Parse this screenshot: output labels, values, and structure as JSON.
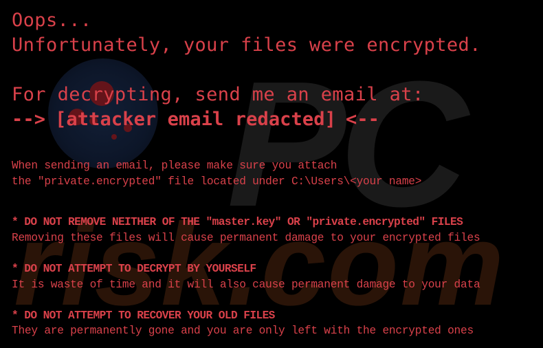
{
  "watermark": {
    "brand_top": "PC",
    "brand_bottom": "risk.com"
  },
  "note": {
    "greeting": "Oops...",
    "headline": "Unfortunately, your files were encrypted.",
    "decrypt_prompt": "For decrypting, send me an email at:",
    "contact": {
      "prefix": "-->",
      "address": "[attacker email redacted]",
      "suffix": "<--"
    },
    "attach_instructions": [
      "When sending an email, please make sure you attach",
      "the \"private.encrypted\" file located under C:\\Users\\<your name>"
    ],
    "warnings": [
      {
        "title": "* DO NOT REMOVE NEITHER OF THE \"master.key\" OR \"private.encrypted\" FILES",
        "detail": "Removing these files will cause permanent damage to your encrypted files"
      },
      {
        "title": "* DO NOT ATTEMPT TO DECRYPT BY YOURSELF",
        "detail": "It is waste of time and it will also cause permanent damage to your data"
      },
      {
        "title": "* DO NOT ATTEMPT TO RECOVER YOUR OLD FILES",
        "detail": "They are permanently gone and you are only left with the encrypted ones"
      }
    ]
  },
  "colors": {
    "text": "#d9414a",
    "background": "#000000"
  }
}
